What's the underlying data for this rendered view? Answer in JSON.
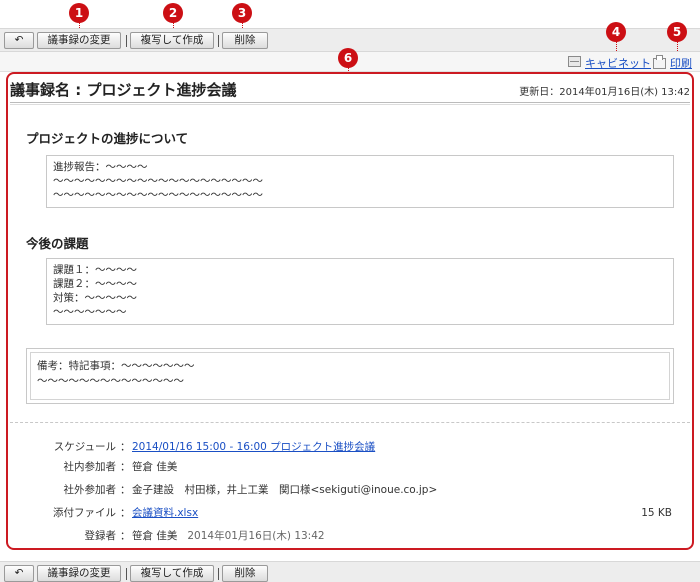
{
  "toolbar": {
    "back_label": "↶",
    "change_label": "議事録の変更",
    "copy_label": "複写して作成",
    "delete_label": "削除"
  },
  "callouts": [
    "1",
    "2",
    "3",
    "4",
    "5",
    "6"
  ],
  "subbar": {
    "cabinet_label": "キャビネット",
    "print_label": "印刷"
  },
  "doc": {
    "title": "議事録名 : プロジェクト進捗会議",
    "updated": "更新日：2014年01月16日(木) 13:42"
  },
  "sections": [
    {
      "heading": "プロジェクトの進捗について",
      "lines": [
        "進捗報告：〜〜〜〜",
        "〜〜〜〜〜〜〜〜〜〜〜〜〜〜〜〜〜〜〜〜",
        "〜〜〜〜〜〜〜〜〜〜〜〜〜〜〜〜〜〜〜〜"
      ]
    },
    {
      "heading": "今後の課題",
      "lines": [
        "課題１：〜〜〜〜",
        "課題２：〜〜〜〜",
        "対策：〜〜〜〜〜",
        "〜〜〜〜〜〜〜"
      ]
    }
  ],
  "note": {
    "lines": [
      "備考：特記事項：〜〜〜〜〜〜〜",
      "〜〜〜〜〜〜〜〜〜〜〜〜〜〜"
    ]
  },
  "info": {
    "schedule_label": "スケジュール",
    "schedule_value": "2014/01/16 15:00 - 16:00 プロジェクト進捗会議",
    "internal_label": "社内参加者",
    "internal_value": "笹倉 佳美",
    "external_label": "社外参加者",
    "external_value": "金子建設　村田様，井上工業　関口様<sekiguti@inoue.co.jp>",
    "attach_label": "添付ファイル",
    "attach_value": "会議資料.xlsx",
    "attach_size": "15 KB",
    "registrant_label": "登録者",
    "registrant_value": "笹倉 佳美",
    "registrant_time": "2014年01月16日(木) 13:42",
    "colon": "："
  }
}
